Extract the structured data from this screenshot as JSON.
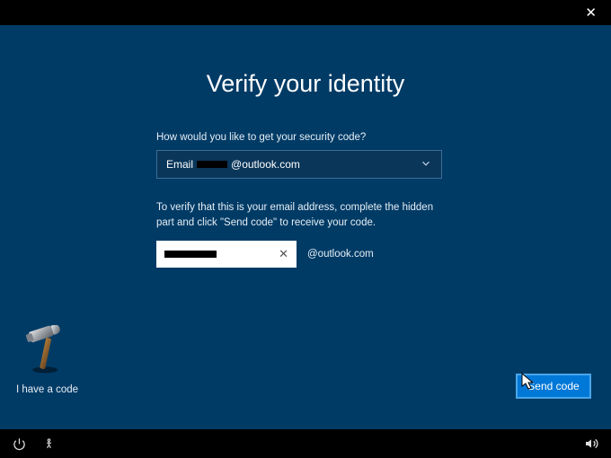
{
  "title": "Verify your identity",
  "prompt": "How would you like to get your security code?",
  "selectValuePrefix": "Email ",
  "selectValueDomain": "@outlook.com",
  "instruction": "To verify that this is your email address, complete the hidden part and click \"Send code\" to receive your code.",
  "domainSuffix": "@outlook.com",
  "haveCodeLabel": "I have a code",
  "sendButtonLabel": "Send code"
}
